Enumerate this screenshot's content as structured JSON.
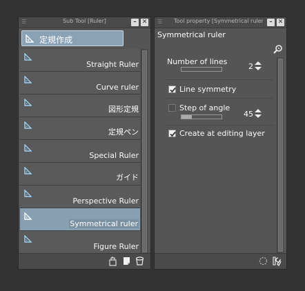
{
  "left_panel": {
    "title": "Sub Tool [Ruler]",
    "group_label": "定規作成",
    "items": [
      {
        "label": "Straight Ruler",
        "selected": false
      },
      {
        "label": "Curve ruler",
        "selected": false
      },
      {
        "label": "図形定規",
        "selected": false
      },
      {
        "label": "定規ペン",
        "selected": false
      },
      {
        "label": "Special Ruler",
        "selected": false
      },
      {
        "label": "ガイド",
        "selected": false
      },
      {
        "label": "Perspective Ruler",
        "selected": false
      },
      {
        "label": "Symmetrical ruler",
        "selected": true
      },
      {
        "label": "Figure Ruler",
        "selected": false
      }
    ]
  },
  "right_panel": {
    "title": "Tool property [Symmetrical ruler]",
    "tool_name": "Symmetrical ruler",
    "number_of_lines": {
      "label": "Number of lines",
      "value": "2",
      "level": 0.0
    },
    "line_symmetry": {
      "label": "Line symmetry",
      "checked": true
    },
    "step_of_angle": {
      "label": "Step of angle",
      "value": "45",
      "checked": false,
      "level": 0.25
    },
    "create_at_editing_layer": {
      "label": "Create at editing layer",
      "checked": true
    }
  },
  "colors": {
    "background": "#333333",
    "panel": "#555555",
    "selection": "#87a0b3",
    "ruler_icon": "#9fd3f5"
  },
  "icons": {
    "ruler": "triangle-ruler-icon",
    "minimize": "minimize-icon",
    "close": "close-icon",
    "copy": "copy-subtool-icon",
    "new": "new-subtool-icon",
    "delete": "delete-icon",
    "reset": "reset-icon",
    "settings": "wrench-icon"
  }
}
